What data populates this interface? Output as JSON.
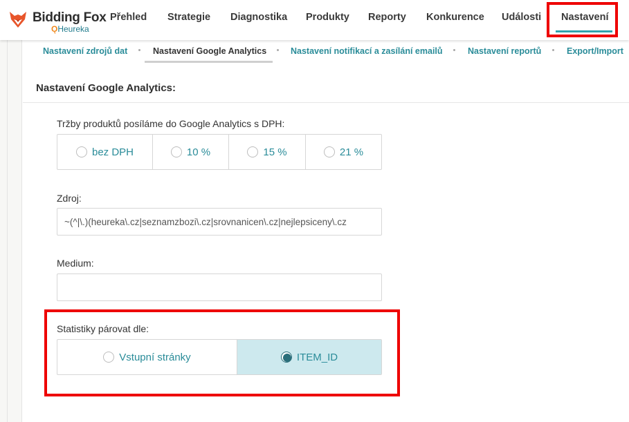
{
  "brand": {
    "title": "Bidding Fox",
    "subtitle": "Heureka",
    "colors": {
      "accent": "#2a8c99",
      "fox": "#e8552a",
      "highlight": "#ee0000"
    }
  },
  "nav": {
    "items": [
      {
        "label": "Přehled"
      },
      {
        "label": "Strategie"
      },
      {
        "label": "Diagnostika"
      },
      {
        "label": "Produkty"
      },
      {
        "label": "Reporty"
      },
      {
        "label": "Konkurence"
      },
      {
        "label": "Události"
      },
      {
        "label": "Nastavení",
        "active": true
      }
    ]
  },
  "subnav": {
    "items": [
      {
        "label": "Nastavení zdrojů dat"
      },
      {
        "label": "Nastavení Google Analytics",
        "active": true
      },
      {
        "label": "Nastavení notifikací a zasílání emailů"
      },
      {
        "label": "Nastavení reportů"
      },
      {
        "label": "Export/Import"
      }
    ]
  },
  "section": {
    "title": "Nastavení Google Analytics:"
  },
  "vat": {
    "label": "Tržby produktů posíláme do Google Analytics s DPH:",
    "options": [
      "bez DPH",
      "10 %",
      "15 %",
      "21 %"
    ],
    "selected": null
  },
  "source": {
    "label": "Zdroj:",
    "value": "~(^|\\.)(heureka\\.cz|seznamzbozi\\.cz|srovnanicen\\.cz|nejlepsiceny\\.cz"
  },
  "medium": {
    "label": "Medium:",
    "value": ""
  },
  "pairing": {
    "label": "Statistiky párovat dle:",
    "options": [
      "Vstupní stránky",
      "ITEM_ID"
    ],
    "selected": "ITEM_ID"
  }
}
